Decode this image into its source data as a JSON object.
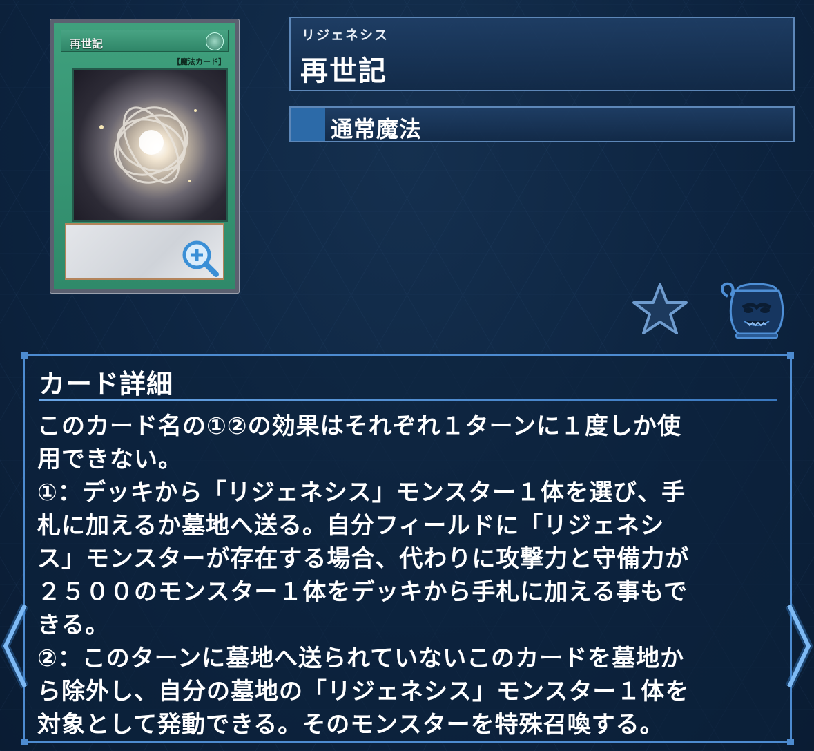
{
  "card": {
    "name_on_art": "再世記",
    "type_on_art": "【魔法カード】",
    "ruby": "リジェネシス",
    "title": "再世記",
    "card_type": "通常魔法"
  },
  "icons": {
    "zoom": "zoom-in-icon",
    "favorite": "star-icon",
    "pot": "pot-icon",
    "nav_left": "chevron-left-icon",
    "nav_right": "chevron-right-icon"
  },
  "details": {
    "heading": "カード詳細",
    "lines": [
      "このカード名の①②の効果はそれぞれ１ターンに１度しか使",
      "用できない。",
      "①：デッキから「リジェネシス」モンスター１体を選び、手",
      "札に加えるか墓地へ送る。自分フィールドに「リジェネシ",
      "ス」モンスターが存在する場合、代わりに攻撃力と守備力が",
      "２５００のモンスター１体をデッキから手札に加える事もで",
      "きる。",
      "②：このターンに墓地へ送られていないこのカードを墓地か",
      "ら除外し、自分の墓地の「リジェネシス」モンスター１体を",
      "対象として発動できる。そのモンスターを特殊召喚する。"
    ]
  },
  "colors": {
    "panel_border": "#4d8bd0",
    "spell_green": "#3fa07d",
    "type_swatch": "#2c6aa8"
  }
}
